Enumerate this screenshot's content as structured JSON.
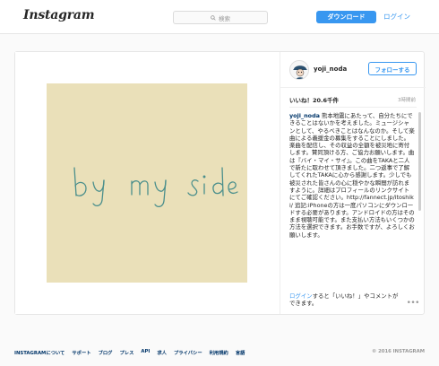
{
  "header": {
    "logo": "Instagram",
    "search_placeholder": "検索",
    "download_label": "ダウンロード",
    "login_label": "ログイン"
  },
  "post": {
    "username": "yoji_noda",
    "follow_label": "フォローする",
    "likes": "いいね！20.6千件",
    "time_ago": "3時間前",
    "photo_text": "by my side",
    "caption_username": "yoji_noda",
    "caption_body": " 熊本地震にあたって、自分たちにできることはないかを考えました。ミュージシャンとして、やるべきことはなんなのか。そして楽曲による義援金の募集をすることにしました。楽曲を配信し、その収益の全額を被災地に寄付します。賛同頂ける方、ご協力お願いします。曲は『バイ・マイ・サイ』。この曲をTAKAと二人で新たに取わせて頂きました。二つ返事で了解してくれたTAKAに心から感謝します。少しでも被災された皆さんの心に穏やかな瞬間が訪れますように。詳細はプロフィールのリンクサイトにてご確認ください。http://fannect.jp/itoshiki/ 追記:iPhoneの方は一度パソコンにダウンロードする必要があります。アンドロイドの方はそのまま視聴可能です。また支払い方法もいくつかの方法を選択できます。お手数ですが、よろしくお願いします。",
    "login_link": "ログイン",
    "login_suffix": "すると「いいね！」やコメントができます。",
    "more_icon": "•••"
  },
  "footer": {
    "links": [
      "INSTAGRAMについて",
      "サポート",
      "ブログ",
      "プレス",
      "API",
      "求人",
      "プライバシー",
      "利用規約",
      "言語"
    ],
    "copyright": "© 2016 INSTAGRAM"
  },
  "colors": {
    "accent": "#3897f0",
    "link": "#003569",
    "photo_bg": "#ece3bc",
    "ink": "#4b8f8c"
  }
}
